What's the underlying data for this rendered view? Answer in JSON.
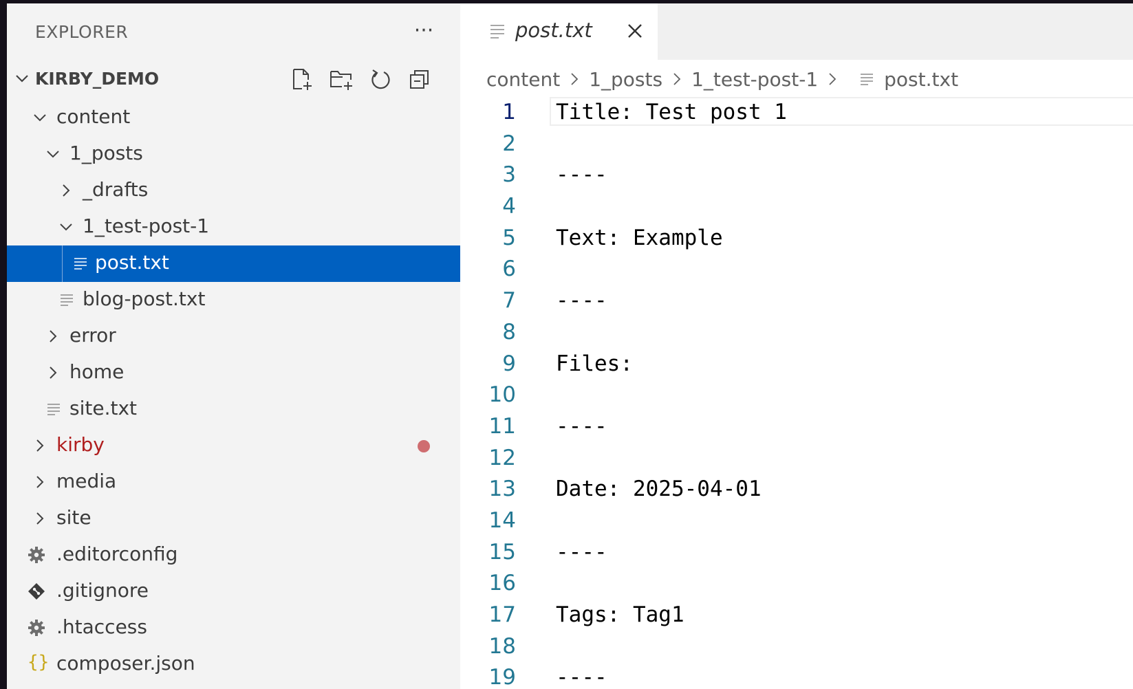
{
  "sidebar": {
    "title": "EXPLORER",
    "more_icon": "ellipsis-icon",
    "section_title": "KIRBY_DEMO",
    "actions": [
      "new-file-icon",
      "new-folder-icon",
      "refresh-icon",
      "collapse-all-icon"
    ]
  },
  "tree": [
    {
      "label": "content"
    },
    {
      "label": "1_posts"
    },
    {
      "label": "_drafts"
    },
    {
      "label": "1_test-post-1"
    },
    {
      "label": "post.txt"
    },
    {
      "label": "blog-post.txt"
    },
    {
      "label": "error"
    },
    {
      "label": "home"
    },
    {
      "label": "site.txt"
    },
    {
      "label": "kirby"
    },
    {
      "label": "media"
    },
    {
      "label": "site"
    },
    {
      "label": ".editorconfig"
    },
    {
      "label": ".gitignore"
    },
    {
      "label": ".htaccess"
    },
    {
      "label": "composer.json"
    }
  ],
  "colors": {
    "selection": "#0060c0",
    "modified": "#b01e1e",
    "line_number": "#237893",
    "json_icon": "#c8a81a"
  },
  "editor": {
    "tab_label": "post.txt",
    "breadcrumb": [
      "content",
      "1_posts",
      "1_test-post-1",
      "post.txt"
    ],
    "lines": [
      "Title: Test post 1",
      "",
      "----",
      "",
      "Text: Example",
      "",
      "----",
      "",
      "Files:",
      "",
      "----",
      "",
      "Date: 2025-04-01",
      "",
      "----",
      "",
      "Tags: Tag1",
      "",
      "----"
    ],
    "line_numbers": [
      "1",
      "2",
      "3",
      "4",
      "5",
      "6",
      "7",
      "8",
      "9",
      "10",
      "11",
      "12",
      "13",
      "14",
      "15",
      "16",
      "17",
      "18",
      "19"
    ]
  }
}
